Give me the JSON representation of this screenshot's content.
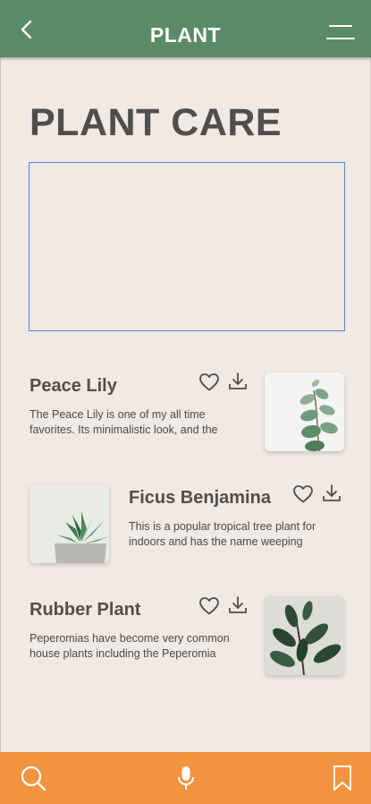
{
  "header": {
    "title": "PLANT",
    "icons": {
      "back": "back-chevron-icon",
      "menu": "menu-icon"
    },
    "color": "#5b8a66"
  },
  "page": {
    "title": "PLANT CARE"
  },
  "plants": [
    {
      "name": "Peace Lily",
      "description_line1": "The Peace Lily is one of my all time",
      "description_line2": "favorites. Its minimalistic look, and the",
      "image": "eucalyptus-sprig-image"
    },
    {
      "name": "Ficus Benjamina",
      "description_line1": "This is a popular tropical tree plant for",
      "description_line2": "indoors and has the name weeping",
      "image": "succulent-pot-image"
    },
    {
      "name": "Rubber Plant",
      "description_line1": "Peperomias have become very common",
      "description_line2": "house plants including the Peperomia",
      "image": "rubber-plant-image"
    }
  ],
  "card_icons": {
    "favorite": "heart-icon",
    "download": "download-icon"
  },
  "bottom_bar": {
    "icons": [
      "search-icon",
      "microphone-icon",
      "bookmark-icon"
    ],
    "color": "#f2933f"
  },
  "colors": {
    "background": "#f1e9e4",
    "hero_border": "#4a89dc"
  }
}
